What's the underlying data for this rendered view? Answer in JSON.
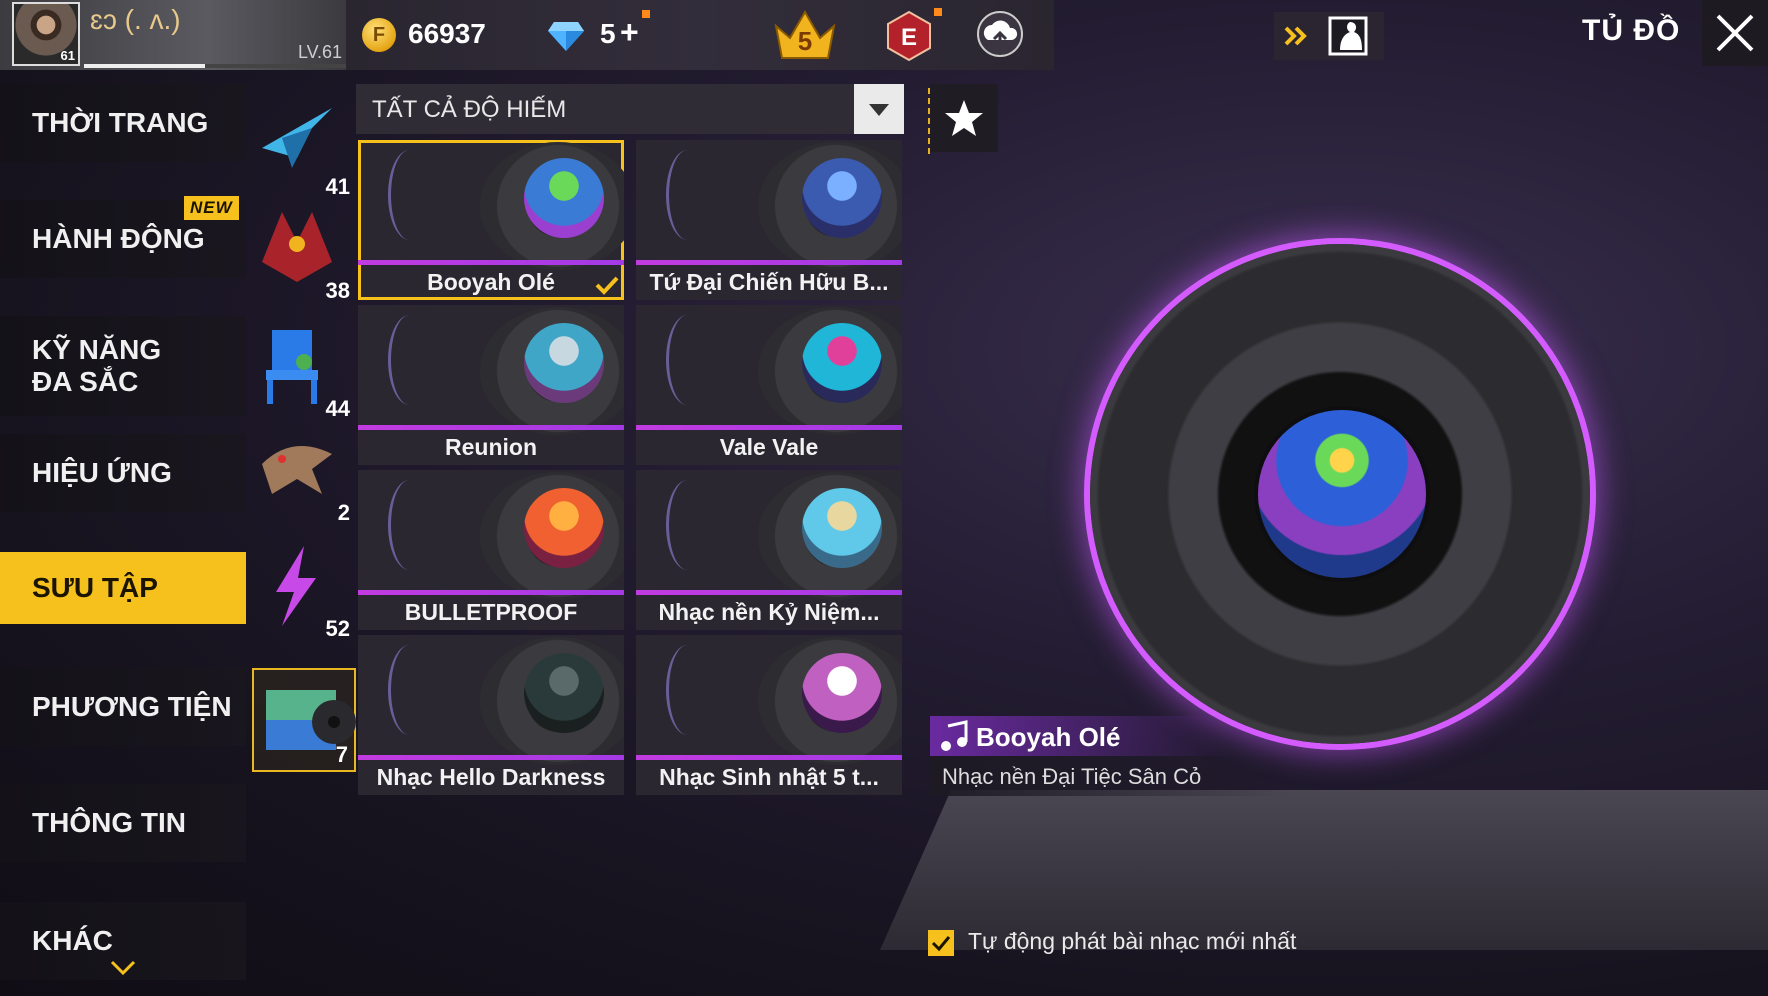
{
  "player": {
    "level_badge": "61",
    "nickname": "ɛͻ (⁠.⁠ ⁠ʌ⁠.⁠)",
    "level_text": "LV.61",
    "xp_fraction": 0.46
  },
  "currency": {
    "gold": "66937",
    "diamonds": "5",
    "plus": "+"
  },
  "badges": {
    "rank_number": "5",
    "elite_letter": "E"
  },
  "screen_title": "TỦ ĐỒ",
  "sidebar": {
    "items": [
      {
        "label": "THỜI TRANG",
        "active": false
      },
      {
        "label": "HÀNH ĐỘNG",
        "active": false
      },
      {
        "label": "KỸ NĂNG ĐA SẮC",
        "active": false
      },
      {
        "label": "HIỆU ỨNG",
        "active": false
      },
      {
        "label": "SƯU TẬP",
        "active": true
      },
      {
        "label": "PHƯƠNG TIỆN",
        "active": false
      },
      {
        "label": "THÔNG TIN",
        "active": false
      },
      {
        "label": "KHÁC",
        "active": false
      }
    ],
    "new_badge": "NEW"
  },
  "categories": [
    {
      "count": "41",
      "icon": "glider-icon"
    },
    {
      "count": "38",
      "icon": "dragon-icon"
    },
    {
      "count": "44",
      "icon": "chair-icon"
    },
    {
      "count": "2",
      "icon": "creature-icon"
    },
    {
      "count": "52",
      "icon": "lightning-icon"
    },
    {
      "count": "7",
      "icon": "music-disc-icon"
    }
  ],
  "filter": {
    "label": "TẤT CẢ ĐỘ HIẾM"
  },
  "tracks": [
    {
      "name": "Booyah Olé",
      "selected": true,
      "art": [
        "#3a7bd5",
        "#6ad95a",
        "#9b3fd0"
      ]
    },
    {
      "name": "Tứ Đại Chiến Hữu B...",
      "selected": false,
      "art": [
        "#3b5bb0",
        "#7ab0ff",
        "#2a2f6a"
      ]
    },
    {
      "name": "Reunion",
      "selected": false,
      "art": [
        "#3fa6c8",
        "#c8d8e0",
        "#6a3a7a"
      ]
    },
    {
      "name": "Vale Vale",
      "selected": false,
      "art": [
        "#1fb6d8",
        "#e0409a",
        "#2a2a5a"
      ]
    },
    {
      "name": "BULLETPROOF",
      "selected": false,
      "art": [
        "#f06030",
        "#ffb040",
        "#7a2040"
      ]
    },
    {
      "name": "Nhạc nền Kỷ Niệm...",
      "selected": false,
      "art": [
        "#60c8e8",
        "#e8d8a0",
        "#3a6a8a"
      ]
    },
    {
      "name": "Nhạc Hello Darkness",
      "selected": false,
      "art": [
        "#2a3a3a",
        "#5a6a6a",
        "#1a2020"
      ]
    },
    {
      "name": "Nhạc Sinh nhật 5 t...",
      "selected": false,
      "art": [
        "#c060c0",
        "#ffffff",
        "#3a1a4a"
      ]
    }
  ],
  "preview": {
    "title": "Booyah Olé",
    "subtitle": "Nhạc nền Đại Tiệc Sân Cỏ"
  },
  "autoplay": {
    "label": "Tự động phát bài nhạc mới nhất",
    "checked": true
  },
  "colors": {
    "accent": "#f6c11c",
    "purple": "#c23be0"
  }
}
